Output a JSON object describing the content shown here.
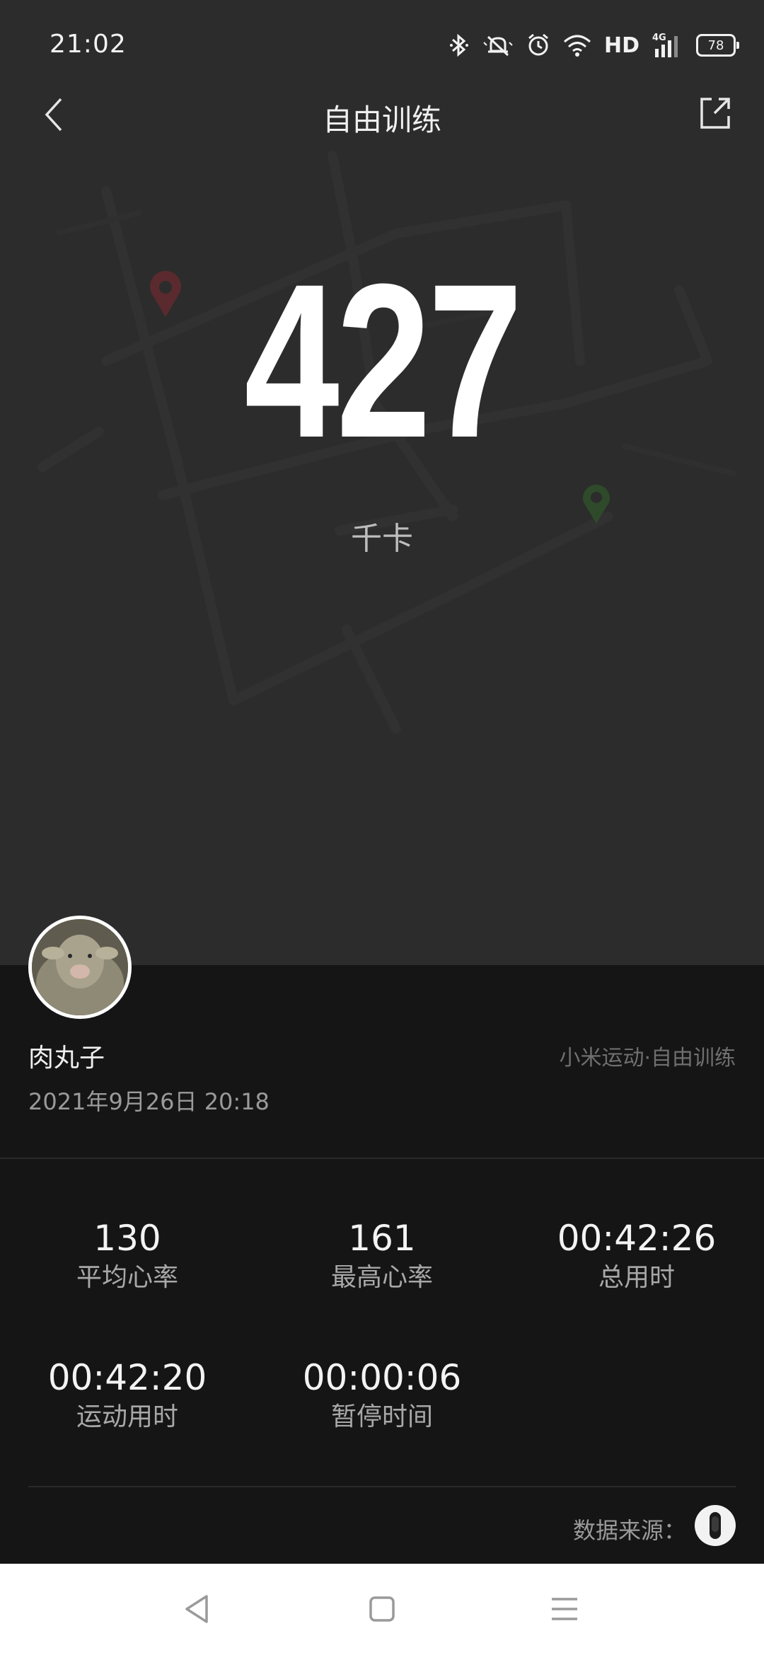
{
  "status": {
    "time": "21:02",
    "network": "HD",
    "signal": "4G",
    "battery": "78"
  },
  "header": {
    "title": "自由训练"
  },
  "summary": {
    "calories": "427",
    "unit": "千卡"
  },
  "user": {
    "name": "肉丸子",
    "source": "小米运动·自由训练",
    "date": "2021年9月26日 20:18"
  },
  "stats": [
    {
      "value": "130",
      "label": "平均心率"
    },
    {
      "value": "161",
      "label": "最高心率"
    },
    {
      "value": "00:42:26",
      "label": "总用时"
    },
    {
      "value": "00:42:20",
      "label": "运动用时"
    },
    {
      "value": "00:00:06",
      "label": "暂停时间"
    }
  ],
  "footer": {
    "data_source_label": "数据来源："
  },
  "colors": {
    "background": "#2c2c2c",
    "panel": "#151515",
    "start_marker": "#5a2a2e",
    "end_marker": "#2e4a2a"
  },
  "icons": [
    "back-icon",
    "share-icon",
    "bluetooth-icon",
    "mute-icon",
    "alarm-icon",
    "wifi-icon",
    "signal-icon",
    "battery-icon",
    "device-icon",
    "back-nav-icon",
    "home-nav-icon",
    "menu-nav-icon"
  ]
}
